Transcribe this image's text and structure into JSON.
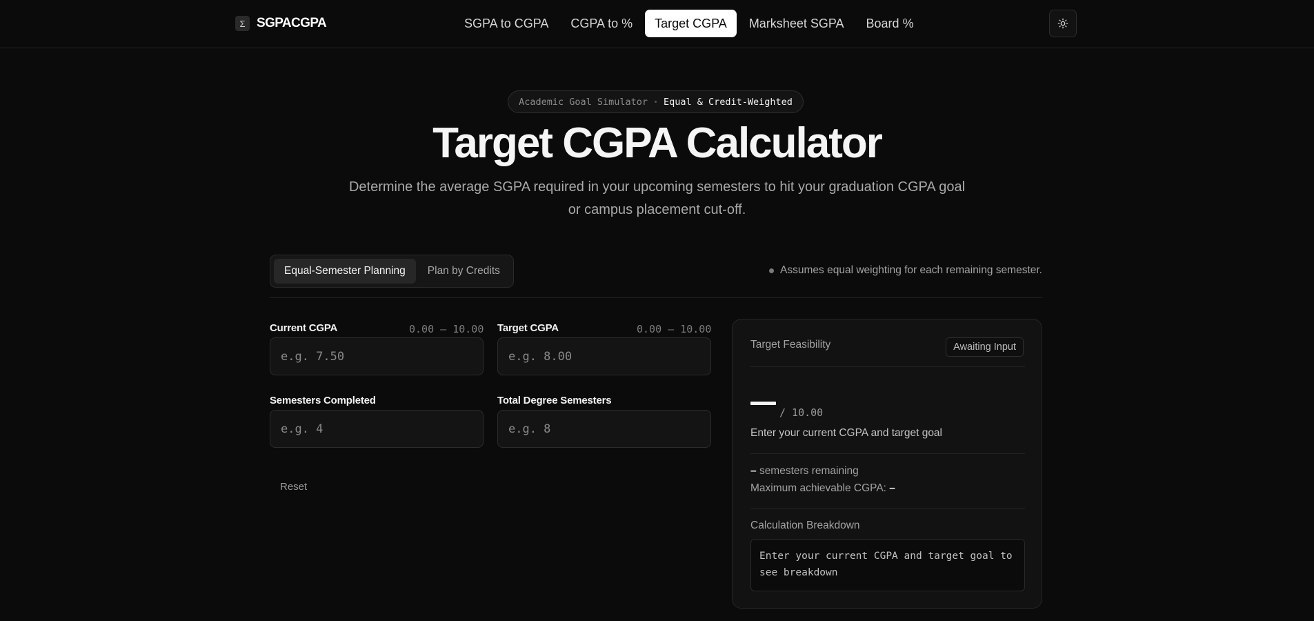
{
  "brand": {
    "mark": "Σ",
    "name": "SGPACGPA"
  },
  "nav": {
    "items": [
      {
        "label": "SGPA to CGPA"
      },
      {
        "label": "CGPA to %"
      },
      {
        "label": "Target CGPA"
      },
      {
        "label": "Marksheet SGPA"
      },
      {
        "label": "Board %"
      }
    ],
    "active_index": 2,
    "theme_toggle_icon": "sun-icon"
  },
  "hero": {
    "pill_left": "Academic Goal Simulator",
    "pill_right": "Equal & Credit-Weighted",
    "title": "Target CGPA Calculator",
    "subtitle": "Determine the average SGPA required in your upcoming semesters to hit your graduation CGPA goal or campus placement cut-off."
  },
  "mode": {
    "tabs": [
      {
        "label": "Equal-Semester Planning"
      },
      {
        "label": "Plan by Credits"
      }
    ],
    "active_index": 0,
    "note": "Assumes equal weighting for each remaining semester."
  },
  "form": {
    "current_cgpa": {
      "label": "Current CGPA",
      "range": "0.00 – 10.00",
      "placeholder": "e.g. 7.50",
      "value": ""
    },
    "target_cgpa": {
      "label": "Target CGPA",
      "range": "0.00 – 10.00",
      "placeholder": "e.g. 8.00",
      "value": ""
    },
    "semesters_completed": {
      "label": "Semesters Completed",
      "placeholder": "e.g. 4",
      "value": ""
    },
    "total_semesters": {
      "label": "Total Degree Semesters",
      "placeholder": "e.g. 8",
      "value": ""
    },
    "reset_label": "Reset"
  },
  "result": {
    "heading": "Target Feasibility",
    "status_badge": "Awaiting Input",
    "out_of": "/ 10.00",
    "message": "Enter your current CGPA and target goal",
    "semesters_remaining_value": "–",
    "semesters_remaining_label": "semesters remaining",
    "max_cgpa_label": "Maximum achievable CGPA:",
    "max_cgpa_value": "–",
    "breakdown_label": "Calculation Breakdown",
    "breakdown_text": "Enter your current CGPA and target goal to see breakdown"
  }
}
